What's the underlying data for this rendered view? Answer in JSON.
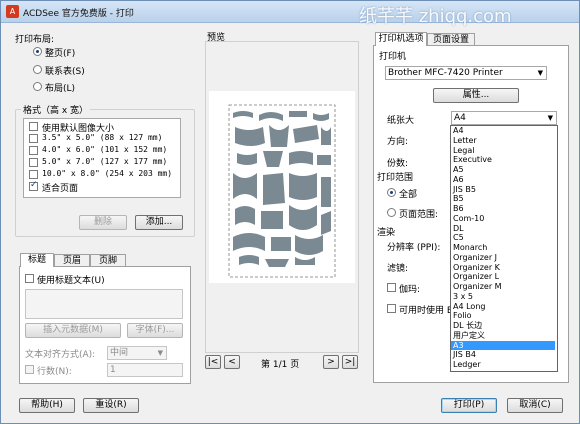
{
  "window": {
    "title": "ACDSee 官方免费版 - 打印",
    "watermark": "纸芊芊 zhiqq.com"
  },
  "layout_group": {
    "title": "打印布局:",
    "options": [
      {
        "label": "整页(F)",
        "selected": true
      },
      {
        "label": "联系表(S)",
        "selected": false
      },
      {
        "label": "布局(L)",
        "selected": false
      }
    ]
  },
  "format_group": {
    "title": "格式（高 x 宽）",
    "items": [
      {
        "label": "使用默认图像大小",
        "checked": false
      },
      {
        "label": "3.5\" x 5.0\" (88 x 127 mm)",
        "checked": false
      },
      {
        "label": "4.0\" x 6.0\" (101 x 152 mm)",
        "checked": false
      },
      {
        "label": "5.0\" x 7.0\" (127 x 177 mm)",
        "checked": false
      },
      {
        "label": "10.0\" x 8.0\" (254 x 203 mm)",
        "checked": false
      },
      {
        "label": "适合页面",
        "checked": true
      }
    ],
    "delete_label": "删除",
    "add_label": "添加..."
  },
  "caption_panel": {
    "tabs": [
      "标题",
      "页眉",
      "页脚"
    ],
    "use_caption_label": "使用标题文本(U)",
    "insert_metadata_label": "插入元数据(M)",
    "font_label": "字体(F)...",
    "alignment_label": "文本对齐方式(A):",
    "alignment_value": "中间",
    "lines_label": "行数(N):",
    "lines_value": "1"
  },
  "preview": {
    "title": "预览",
    "page_label": "第 1/1 页",
    "nav_first": "|<",
    "nav_prev": "<",
    "nav_next": ">",
    "nav_last": ">|"
  },
  "right_panel": {
    "tabs": [
      "打印机选项",
      "页面设置"
    ],
    "printer_group": "打印机",
    "printer_value": "Brother MFC-7420 Printer",
    "properties_label": "属性...",
    "paper_size_label": "纸张大",
    "paper_size_value": "A4",
    "orientation_label": "方向:",
    "copies_label": "份数:",
    "print_range_label": "打印范围",
    "range_all": "全部",
    "range_pages": "页面范围:",
    "render_label": "渲染",
    "resolution_label": "分辨率 (PPI):",
    "filter_label": "滤镜:",
    "gamma_label": "伽玛:",
    "available_label": "可用时使用 E",
    "paper_options": [
      "A4",
      "Letter",
      "Legal",
      "Executive",
      "A5",
      "A6",
      "JIS B5",
      "B5",
      "B6",
      "Com-10",
      "DL",
      "C5",
      "Monarch",
      "Organizer J",
      "Organizer K",
      "Organizer L",
      "Organizer M",
      "3 x 5",
      "A4 Long",
      "Folio",
      "DL 长边",
      "用户定义",
      "A3",
      "JIS B4",
      "Ledger"
    ],
    "paper_selected": "A3"
  },
  "footer": {
    "help_label": "帮助(H)",
    "reset_label": "重设(R)",
    "print_label": "打印(P)",
    "cancel_label": "取消(C)"
  },
  "colors": {
    "selection": "#3399ff",
    "title_bar": "#b9d1ea",
    "window": "#f0f0f0"
  },
  "icons": [
    "acdsee-app-icon",
    "dropdown-arrow-icon",
    "radio-icon",
    "checkbox-icon"
  ]
}
